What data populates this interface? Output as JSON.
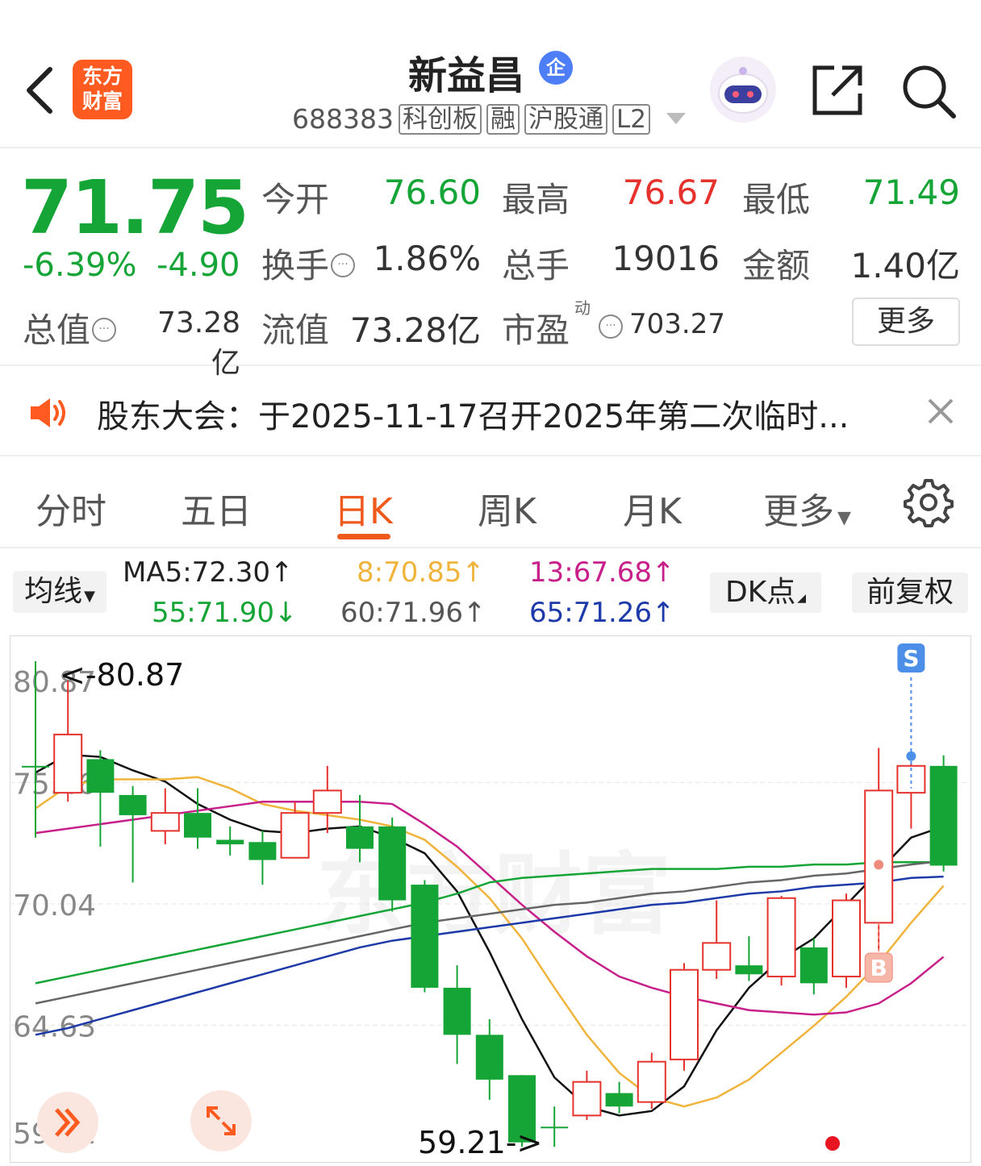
{
  "header": {
    "logo_text": [
      "东方",
      "财富"
    ],
    "stock_name": "新益昌",
    "badge": "企",
    "code": "688383",
    "tags": [
      "科创板",
      "融",
      "沪股通",
      "L2"
    ]
  },
  "quote": {
    "price": "71.75",
    "change_pct": "-6.39%",
    "change_amt": "-4.90",
    "fields": [
      {
        "label": "今开",
        "value": "76.60",
        "color": "green"
      },
      {
        "label": "最高",
        "value": "76.67",
        "color": "red"
      },
      {
        "label": "最低",
        "value": "71.49",
        "color": "green"
      },
      {
        "label": "换手",
        "value": "1.86%",
        "color": "dark"
      },
      {
        "label": "总手",
        "value": "19016",
        "color": "dark"
      },
      {
        "label": "金额",
        "value": "1.40亿",
        "color": "dark"
      }
    ],
    "total_value_label": "总值",
    "total_value": "73.28亿",
    "float_value_label": "流值",
    "float_value": "73.28亿",
    "pe_label": "市盈",
    "pe_sup": "动",
    "pe_value": "703.27",
    "more_label": "更多"
  },
  "notice": {
    "text": "股东大会：于2025-11-17召开2025年第二次临时..."
  },
  "tabs": {
    "items": [
      "分时",
      "五日",
      "日K",
      "周K",
      "月K",
      "更多"
    ],
    "active": "日K"
  },
  "ma_bar": {
    "dropdown_label": "均线",
    "items": [
      {
        "text": "MA5:72.30↑",
        "color": "#222222"
      },
      {
        "text": "8:70.85↑",
        "color": "#f0b43c"
      },
      {
        "text": "13:67.68↑",
        "color": "#c8208a"
      },
      {
        "text": "55:71.90↓",
        "color": "#14a536"
      },
      {
        "text": "60:71.96↑",
        "color": "#555555"
      },
      {
        "text": "65:71.26↑",
        "color": "#1d3aa8"
      }
    ],
    "dk_label": "DK点",
    "fq_label": "前复权"
  },
  "chart_data": {
    "type": "candlestick",
    "y_axis_labels": [
      "80.87",
      "75.46",
      "70.04",
      "64.63",
      "59.21"
    ],
    "ylim": [
      59.21,
      80.87
    ],
    "max_annotation": "<-80.87",
    "min_annotation": "59.21->",
    "signals": [
      {
        "label": "S",
        "index": 27
      },
      {
        "label": "B",
        "index": 26
      }
    ],
    "candles": [
      {
        "o": 76.2,
        "c": 76.2,
        "h": 80.87,
        "l": 73.0
      },
      {
        "o": 75.0,
        "c": 77.6,
        "h": 80.0,
        "l": 74.6
      },
      {
        "o": 76.5,
        "c": 75.0,
        "h": 76.9,
        "l": 72.6
      },
      {
        "o": 74.9,
        "c": 74.0,
        "h": 75.3,
        "l": 71.0
      },
      {
        "o": 73.3,
        "c": 74.1,
        "h": 75.2,
        "l": 72.7
      },
      {
        "o": 74.1,
        "c": 73.0,
        "h": 75.2,
        "l": 72.5
      },
      {
        "o": 72.9,
        "c": 72.7,
        "h": 73.5,
        "l": 72.2
      },
      {
        "o": 72.8,
        "c": 72.0,
        "h": 73.3,
        "l": 70.9
      },
      {
        "o": 72.1,
        "c": 74.1,
        "h": 74.6,
        "l": 72.1
      },
      {
        "o": 74.1,
        "c": 75.1,
        "h": 76.2,
        "l": 73.2
      },
      {
        "o": 73.5,
        "c": 72.5,
        "h": 74.9,
        "l": 71.9
      },
      {
        "o": 73.5,
        "c": 70.2,
        "h": 73.9,
        "l": 69.7
      },
      {
        "o": 70.9,
        "c": 66.3,
        "h": 71.1,
        "l": 66.1
      },
      {
        "o": 66.3,
        "c": 64.2,
        "h": 67.3,
        "l": 62.9
      },
      {
        "o": 64.2,
        "c": 62.2,
        "h": 64.9,
        "l": 61.3
      },
      {
        "o": 62.4,
        "c": 59.4,
        "h": 62.4,
        "l": 59.21
      },
      {
        "o": 60.1,
        "c": 60.1,
        "h": 61.0,
        "l": 59.2
      },
      {
        "o": 60.6,
        "c": 62.1,
        "h": 62.6,
        "l": 60.4
      },
      {
        "o": 61.6,
        "c": 61.0,
        "h": 62.1,
        "l": 60.7
      },
      {
        "o": 61.2,
        "c": 63.0,
        "h": 63.4,
        "l": 60.9
      },
      {
        "o": 63.1,
        "c": 67.1,
        "h": 67.4,
        "l": 62.6
      },
      {
        "o": 67.1,
        "c": 68.3,
        "h": 70.2,
        "l": 66.7
      },
      {
        "o": 67.3,
        "c": 66.9,
        "h": 68.6,
        "l": 66.6
      },
      {
        "o": 66.8,
        "c": 70.3,
        "h": 70.4,
        "l": 66.4
      },
      {
        "o": 68.1,
        "c": 66.5,
        "h": 68.5,
        "l": 66.0
      },
      {
        "o": 66.8,
        "c": 70.2,
        "h": 70.5,
        "l": 66.3
      },
      {
        "o": 69.2,
        "c": 75.1,
        "h": 77.0,
        "l": 68.0
      },
      {
        "o": 75.0,
        "c": 76.2,
        "h": 76.3,
        "l": 73.4
      },
      {
        "o": 76.2,
        "c": 71.75,
        "h": 76.67,
        "l": 71.49
      }
    ],
    "ma_series": [
      {
        "name": "MA5",
        "color": "#111111",
        "values": [
          75.9,
          76.7,
          76.6,
          76.0,
          75.5,
          74.5,
          73.8,
          73.3,
          73.2,
          73.4,
          73.5,
          73.0,
          72.3,
          70.6,
          67.9,
          64.9,
          62.3,
          61.0,
          60.6,
          60.8,
          61.9,
          64.4,
          66.3,
          67.6,
          68.5,
          70.0,
          71.5,
          73.0,
          73.5
        ]
      },
      {
        "name": "MA8",
        "color": "#f0b43c",
        "values": [
          74.3,
          75.3,
          75.6,
          75.6,
          75.6,
          75.7,
          75.2,
          74.5,
          74.2,
          74.0,
          73.8,
          73.5,
          72.9,
          71.7,
          70.3,
          68.5,
          66.3,
          64.2,
          62.5,
          61.4,
          61.0,
          61.4,
          62.2,
          63.4,
          64.6,
          65.9,
          67.4,
          69.2,
          70.85
        ]
      },
      {
        "name": "MA13",
        "color": "#c8208a",
        "values": [
          73.2,
          73.4,
          73.6,
          73.8,
          74.0,
          74.2,
          74.4,
          74.6,
          74.6,
          74.6,
          74.6,
          74.5,
          73.6,
          72.6,
          71.3,
          70.0,
          68.8,
          67.7,
          66.8,
          66.3,
          65.9,
          65.6,
          65.3,
          65.2,
          65.1,
          65.2,
          65.6,
          66.5,
          67.68
        ]
      },
      {
        "name": "MA55",
        "color": "#14a536",
        "values": [
          66.5,
          66.8,
          67.1,
          67.4,
          67.7,
          68.0,
          68.3,
          68.6,
          68.9,
          69.2,
          69.5,
          69.8,
          70.1,
          70.5,
          71.0,
          71.2,
          71.3,
          71.4,
          71.5,
          71.6,
          71.6,
          71.6,
          71.7,
          71.7,
          71.8,
          71.8,
          71.9,
          71.9,
          71.9
        ]
      },
      {
        "name": "MA60",
        "color": "#666666",
        "values": [
          65.6,
          65.9,
          66.2,
          66.5,
          66.8,
          67.1,
          67.4,
          67.7,
          68.0,
          68.3,
          68.6,
          68.9,
          69.2,
          69.4,
          69.6,
          69.8,
          70.0,
          70.1,
          70.3,
          70.5,
          70.6,
          70.8,
          71.0,
          71.1,
          71.3,
          71.4,
          71.6,
          71.8,
          71.96
        ]
      },
      {
        "name": "MA65",
        "color": "#1d3aa8",
        "values": [
          64.2,
          64.5,
          64.9,
          65.3,
          65.7,
          66.1,
          66.5,
          66.9,
          67.3,
          67.7,
          68.1,
          68.4,
          68.6,
          68.8,
          69.0,
          69.2,
          69.4,
          69.6,
          69.8,
          70.0,
          70.1,
          70.3,
          70.5,
          70.6,
          70.8,
          70.9,
          71.0,
          71.2,
          71.26
        ]
      }
    ],
    "grid": true,
    "watermark": "东方财富"
  }
}
